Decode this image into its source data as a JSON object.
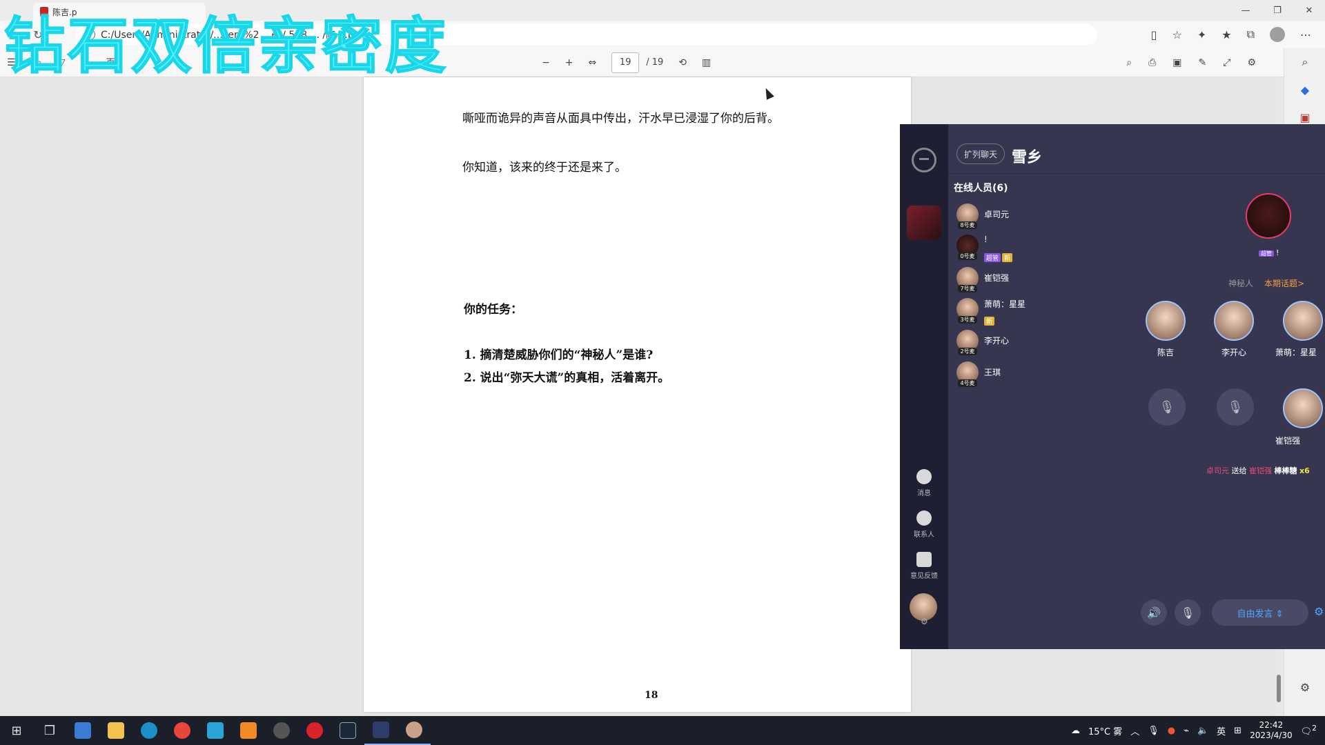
{
  "browser": {
    "tab_title": "陈吉.p",
    "url_text": "C:/Users/Administrator/...cent%2 ...es/ 548 ... /陈 ...p",
    "window_controls": [
      "—",
      "❐",
      "✕"
    ]
  },
  "watermark": {
    "text": "钻石双倍亲密度",
    "color": "#4ff3ff"
  },
  "pdf_toolbar": {
    "left_tools": [
      "☰",
      "▭",
      "▽",
      "◇",
      "页▾"
    ],
    "zoom_out": "−",
    "zoom_in": "+",
    "current_page": "19",
    "total_pages": "/ 19"
  },
  "pdf_page": {
    "lines": [
      "嘶哑而诡异的声音从面具中传出，汗水早已浸湿了你的后背。",
      "你知道，该来的终于还是来了。",
      "你的任务：",
      "1.  摘清楚威胁你们的“神秘人”是谁?",
      "2.  说出“弥天大谎”的真相，活着离开。"
    ],
    "page_number": "18"
  },
  "chat_app": {
    "room_tag": "扩列聊天",
    "room_name": "雪乡",
    "online_title": "在线人员(6)",
    "members": [
      {
        "seat": "8号麦",
        "name": "卓司元",
        "badges": []
      },
      {
        "seat": "0号麦",
        "name": "!",
        "badges": [
          "超管",
          "新"
        ]
      },
      {
        "seat": "7号麦",
        "name": "崔铠强",
        "badges": []
      },
      {
        "seat": "3号麦",
        "name": "萧萌：星星",
        "badges": [
          "新"
        ]
      },
      {
        "seat": "2号麦",
        "name": "李开心",
        "badges": []
      },
      {
        "seat": "4号麦",
        "name": "王琪",
        "badges": []
      }
    ],
    "host": {
      "badge": "超管",
      "name": "!"
    },
    "mystery_label": "神秘人",
    "topic_link": "本期话题>",
    "stage_seats": [
      {
        "name": "陈吉"
      },
      {
        "name": "李开心"
      },
      {
        "name": "萧萌：星星"
      }
    ],
    "stage_seat_bottom": {
      "name": "崔铠强"
    },
    "gift": {
      "from": "卓司元",
      "action": "送给",
      "to": "崔铠强",
      "item": "棒棒糖",
      "count": "x6"
    },
    "free_speak": "自由发言 ⇕",
    "side_nav": [
      {
        "label": "消息"
      },
      {
        "label": "联系人"
      },
      {
        "label": "意见反馈"
      }
    ]
  },
  "taskbar": {
    "weather": "15°C 雾",
    "lang": "英",
    "time": "22:42",
    "date": "2023/4/30",
    "notif_count": "2"
  }
}
